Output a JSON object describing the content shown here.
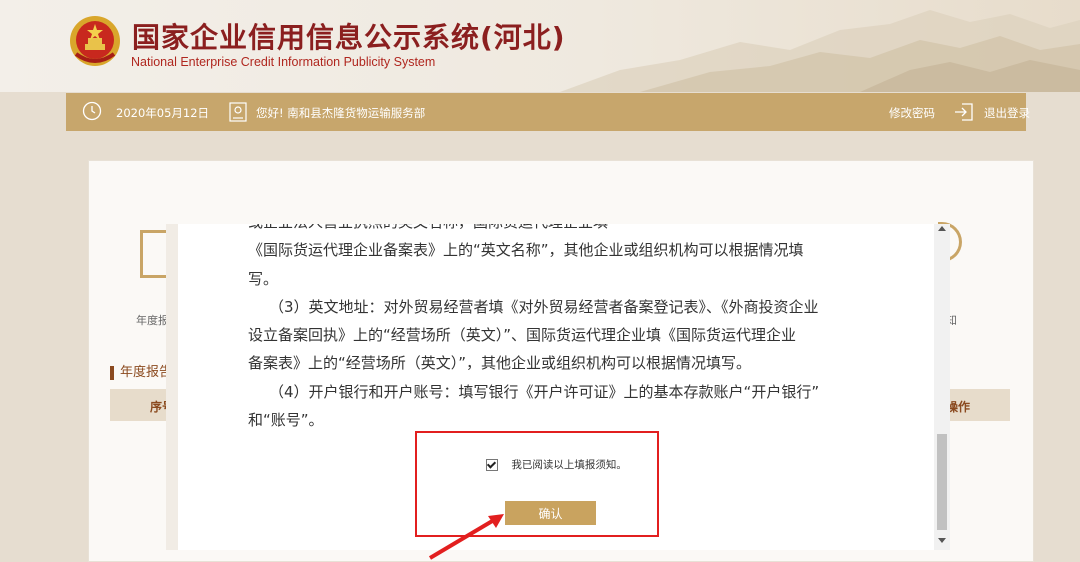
{
  "header": {
    "title": "国家企业信用信息公示系统(河北)",
    "subtitle": "National Enterprise Credit Information Publicity System"
  },
  "topbar": {
    "date": "2020年05月12日",
    "greeting": "您好! 南和县杰隆货物运输服务部",
    "change_password": "修改密码",
    "logout": "退出登录"
  },
  "background_page": {
    "left_item_label": "年度报",
    "right_item_label": "知",
    "section_title": "年度报告",
    "table_col_left": "序号",
    "table_col_right": "操作"
  },
  "notice": {
    "lines": [
      "或企业法人营业执照的英文名称，国际货运代理企业填",
      "《国际货运代理企业备案表》上的“英文名称”，其他企业或组织机构可以根据情况填",
      "写。",
      "（3）英文地址：对外贸易经营者填《对外贸易经营者备案登记表》、《外商投资企业",
      "设立备案回执》上的“经营场所（英文）”、国际货运代理企业填《国际货运代理企业",
      "备案表》上的“经营场所（英文）”，其他企业或组织机构可以根据情况填写。",
      "（4）开户银行和开户账号：填写银行《开户许可证》上的基本存款账户“开户银行”",
      "和“账号”。"
    ]
  },
  "agreement": {
    "checked": true,
    "label": "我已阅读以上填报须知。"
  },
  "confirm_label": "确认",
  "colors": {
    "accent_gold": "#c7a66c",
    "title_red": "#8b1f1f",
    "highlight_red": "#e21f1f"
  }
}
